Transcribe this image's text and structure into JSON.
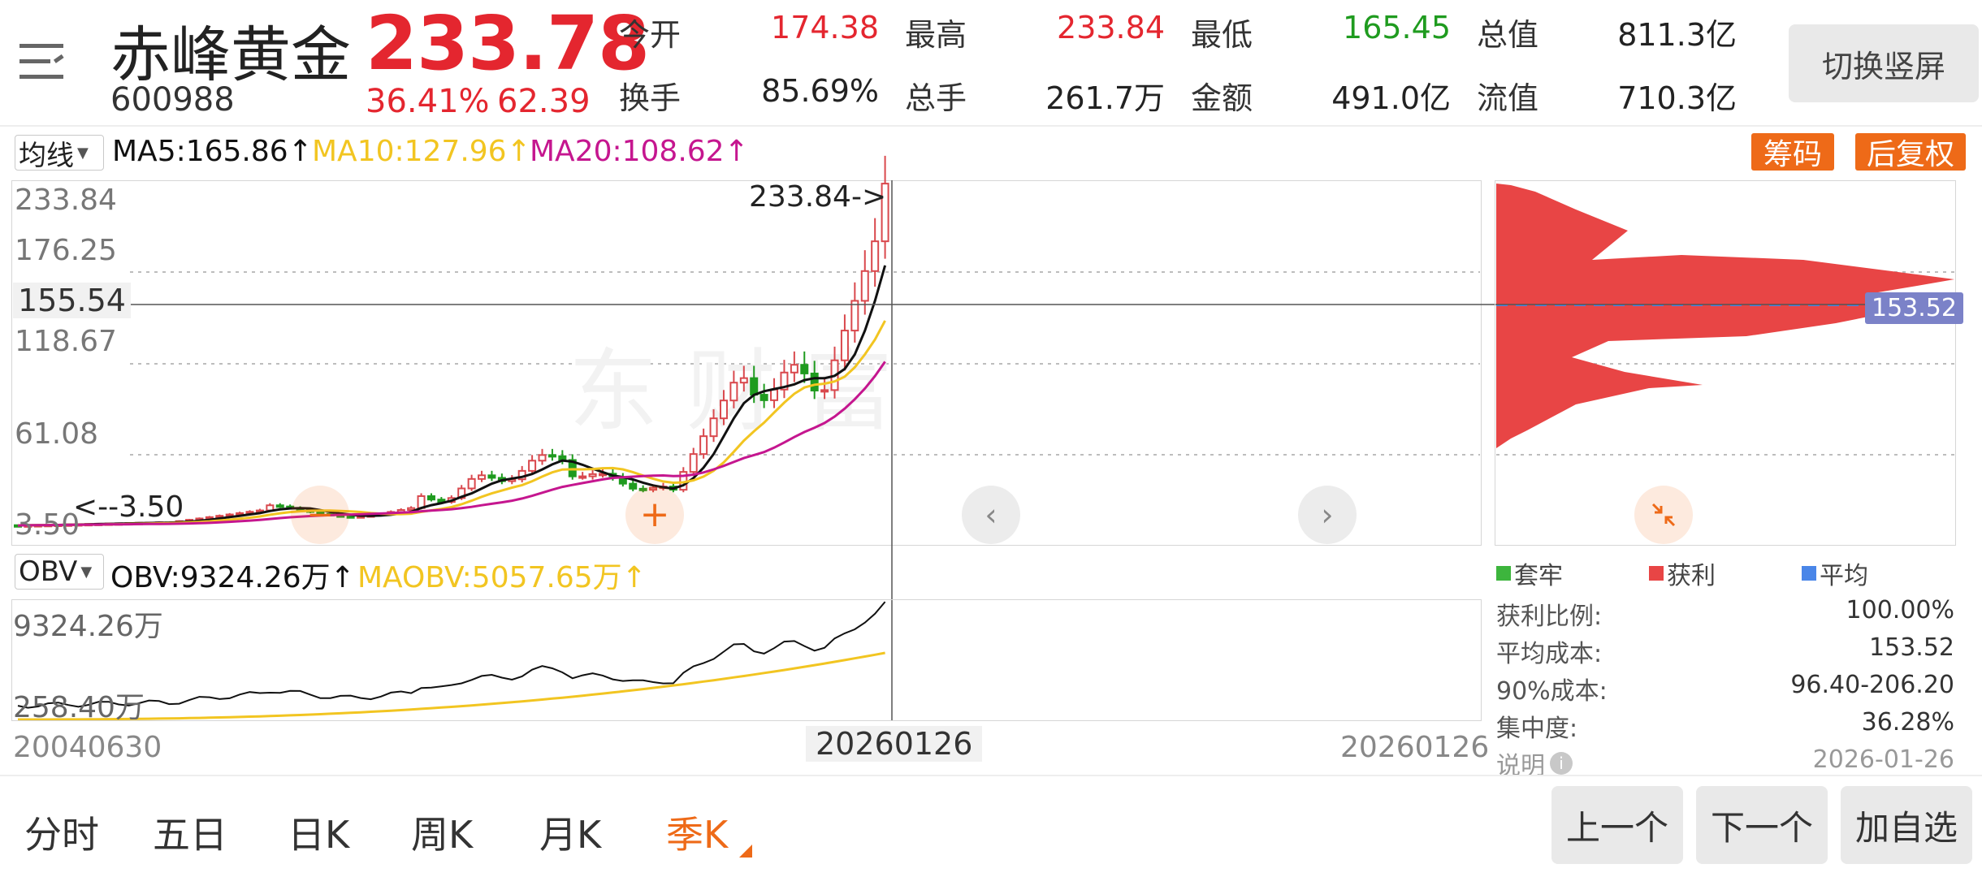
{
  "header": {
    "stock_name": "赤峰黄金",
    "stock_code": "600988",
    "price": "233.78",
    "change_pct": "36.41%",
    "change_amt": "62.39",
    "quote": [
      {
        "label": "今开",
        "value": "174.38",
        "color": "#e4262f"
      },
      {
        "label": "最高",
        "value": "233.84",
        "color": "#e4262f"
      },
      {
        "label": "最低",
        "value": "165.45",
        "color": "#1f9b1f"
      },
      {
        "label": "总值",
        "value": "811.3亿",
        "color": "#222222"
      },
      {
        "label": "换手",
        "value": "85.69%",
        "color": "#222222"
      },
      {
        "label": "总手",
        "value": "261.7万",
        "color": "#222222"
      },
      {
        "label": "金额",
        "value": "491.0亿",
        "color": "#222222"
      },
      {
        "label": "流值",
        "value": "710.3亿",
        "color": "#222222"
      }
    ],
    "switch_label": "切换竖屏"
  },
  "indicators": {
    "ma_select": "均线",
    "ma5": "MA5:165.86↑",
    "ma10": "MA10:127.96↑",
    "ma20": "MA20:108.62↑",
    "chip_button": "筹码",
    "adjust_button": "后复权",
    "obv_select": "OBV",
    "obv": "OBV:9324.26万↑",
    "maobv": "MAOBV:5057.65万↑"
  },
  "colors": {
    "up": "#e4262f",
    "down": "#1f9b1f",
    "ma5": "#111111",
    "ma10": "#f2c521",
    "ma20": "#c5168f",
    "accent": "#ee6a18",
    "chip_profit": "#e84545",
    "chip_avg": "#4a86e8"
  },
  "kline": {
    "y_labels": [
      "233.84",
      "176.25",
      "118.67",
      "61.08",
      "3.50"
    ],
    "cursor_price": "155.54",
    "max_marker": "233.84->",
    "min_marker": "<--3.50",
    "obv_labels": [
      "9324.26万",
      "258.40万"
    ],
    "x_start": "20040630",
    "x_cursor": "20260126",
    "x_end": "20260126"
  },
  "chip": {
    "avg_cost_tag": "153.52",
    "legend": [
      {
        "label": "套牢",
        "color": "#3db53d"
      },
      {
        "label": "获利",
        "color": "#e84545"
      },
      {
        "label": "平均",
        "color": "#4a86e8"
      }
    ],
    "stats": [
      {
        "label": "获利比例:",
        "value": "100.00%"
      },
      {
        "label": "平均成本:",
        "value": "153.52"
      },
      {
        "label": "90%成本:",
        "value": "96.40-206.20"
      },
      {
        "label": "集中度:",
        "value": "36.28%"
      }
    ],
    "note_label": "说明",
    "date": "2026-01-26"
  },
  "periods": [
    "分时",
    "五日",
    "日K",
    "周K",
    "月K",
    "季K"
  ],
  "active_period": "季K",
  "buttons": {
    "prev": "上一个",
    "next": "下一个",
    "add_fav": "加自选"
  }
}
